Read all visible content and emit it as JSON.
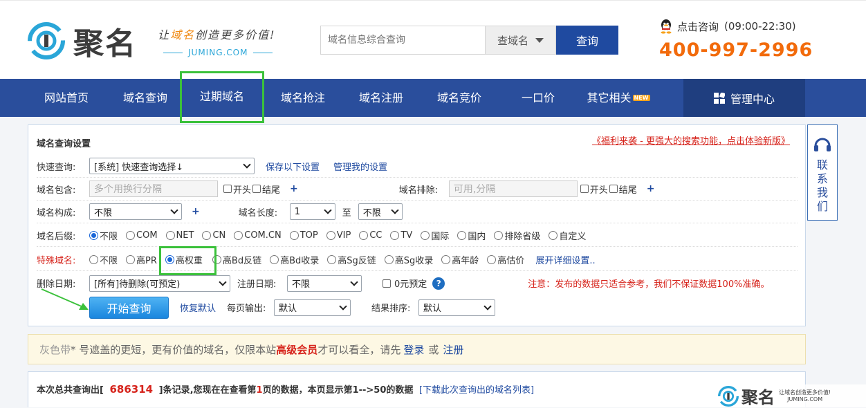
{
  "header": {
    "logo_name": "聚名",
    "slogan_pre": "让",
    "slogan_hl": "域名",
    "slogan_post": "创造更多价值!",
    "slogan_domain": "JUMING.COM",
    "search_placeholder": "域名信息综合查询",
    "search_type": "查域名",
    "search_button": "查询",
    "consult": "点击咨询",
    "hours": "(09:00-22:30)",
    "phone": "400-997-2996"
  },
  "nav": {
    "items": [
      "网站首页",
      "域名查询",
      "过期域名",
      "域名抢注",
      "域名注册",
      "域名竞价",
      "一口价",
      "其它相关"
    ],
    "new_badge": "NEW",
    "admin": "管理中心"
  },
  "panel": {
    "title": "域名查询设置",
    "promo": "《福利来袭 - 更强大的搜索功能，点击体验新版》",
    "quick_label": "快速查询:",
    "quick_value": "[系统] 快速查询选择↓",
    "save_settings": "保存以下设置",
    "manage_settings": "管理我的设置",
    "contains_label": "域名包含:",
    "contains_placeholder": "多个用换行分隔",
    "start": "开头",
    "end": "结尾",
    "plus": "+",
    "exclude_label": "域名排除:",
    "exclude_placeholder": "可用,分隔",
    "compose_label": "域名构成:",
    "compose_value": "不限",
    "length_label": "域名长度:",
    "length_from": "1",
    "length_to_label": "至",
    "length_to": "不限",
    "suffix_label": "域名后缀:",
    "suffix_options": [
      "不限",
      "COM",
      "NET",
      "CN",
      "COM.CN",
      "TOP",
      "VIP",
      "CC",
      "TV",
      "国际",
      "国内",
      "排除省级",
      "自定义"
    ],
    "special_label": "特殊域名:",
    "special_options": [
      "不限",
      "高PR",
      "高权重",
      "高Bd反链",
      "高Bd收录",
      "高Sg反链",
      "高Sg收录",
      "高年龄",
      "高估价"
    ],
    "expand": "展开详细设置..",
    "delete_label": "删除日期:",
    "delete_value": "[所有]待删除(可预定)",
    "reg_label": "注册日期:",
    "reg_value": "不限",
    "zero_reserve": "0元预定",
    "help": "?",
    "warning": "注意：发布的数据只适合参考，我们不保证数据100%准确。",
    "start_button": "开始查询",
    "reset": "恢复默认",
    "per_page_label": "每页输出:",
    "per_page_value": "默认",
    "sort_label": "结果排序:",
    "sort_value": "默认"
  },
  "side": {
    "contact": "联系我们"
  },
  "notice": {
    "gray_band": "灰色带",
    "text1": " * 号遮盖的更短，更有价值的域名，仅限本站",
    "member": "高级会员",
    "text2": "才可以看全，请先",
    "login": "登录",
    "or": "或",
    "register": "注册"
  },
  "result": {
    "pre": "本次总共查询出[",
    "total": "686314",
    "mid": "]条记录,您现在在查看第",
    "page": "1",
    "post": "页的数据，本页显示第1-->50的数据",
    "download": "[下载此次查询出的域名列表]"
  },
  "watermark": {
    "name": "聚名",
    "slogan": "让域名创造更多价值!",
    "domain": "JUMING.COM"
  },
  "colors": {
    "brand": "#2a4e9c",
    "phone": "#f26b0c",
    "highlight": "#3bc13b",
    "warning": "#d6231b"
  }
}
